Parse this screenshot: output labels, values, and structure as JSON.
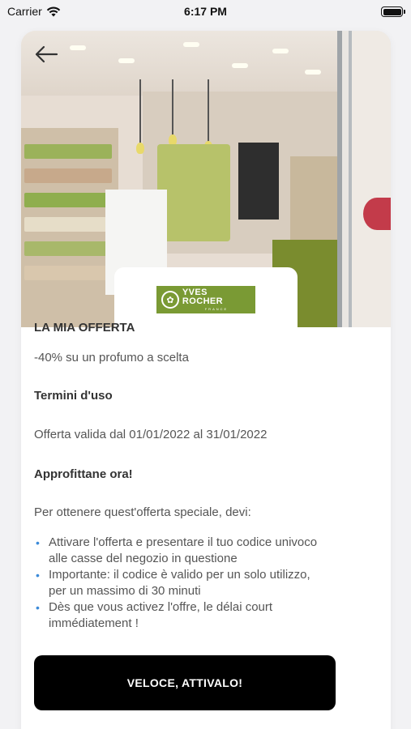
{
  "status_bar": {
    "carrier": "Carrier",
    "time": "6:17 PM",
    "wifi_icon": "wifi-icon",
    "battery_icon": "battery-icon"
  },
  "hero": {
    "back_icon": "arrow-left-icon",
    "store_photo": "store-interior-photo"
  },
  "brand": {
    "name": "YVES ROCHER",
    "sub": "FRANCE",
    "color": "#7a9a34"
  },
  "offer": {
    "heading": "LA MIA OFFERTA",
    "text": "-40% su un profumo a scelta"
  },
  "terms": {
    "heading": "Termini d'uso",
    "text": "Offerta valida dal 01/01/2022 al 31/01/2022"
  },
  "cta_section": {
    "heading": "Approfittane ora!",
    "intro": "Per ottenere quest'offerta speciale, devi:",
    "bullets": [
      "Attivare l'offerta e presentare il tuo codice univoco alle casse del negozio in questione",
      "Importante: il codice è valido per un solo utilizzo, per un massimo di 30 minuti",
      "Dès que vous activez l'offre, le délai court immédiatement !"
    ],
    "bullet_color": "#3c8bd9"
  },
  "activate_button": {
    "label": "VELOCE, ATTIVALO!"
  }
}
